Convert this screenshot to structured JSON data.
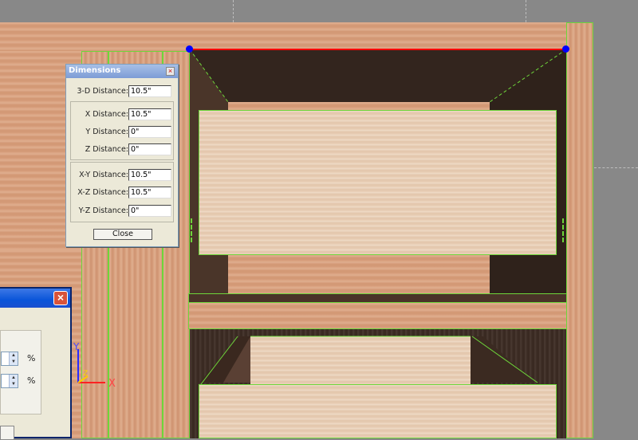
{
  "dimensions_dialog": {
    "title": "Dimensions",
    "close_glyph": "×",
    "rows": [
      {
        "label": "3-D Distance:",
        "value": "10.5\""
      },
      {
        "label": "X Distance:",
        "value": "10.5\""
      },
      {
        "label": "Y Distance:",
        "value": "0\""
      },
      {
        "label": "Z Distance:",
        "value": "0\""
      },
      {
        "label": "X-Y Distance:",
        "value": "10.5\""
      },
      {
        "label": "X-Z Distance:",
        "value": "10.5\""
      },
      {
        "label": "Y-Z Distance:",
        "value": "0\""
      }
    ],
    "close_button": "Close"
  },
  "side_dialog": {
    "close_glyph": "×",
    "percent_1": "%",
    "percent_2": "%"
  },
  "axes": {
    "y_label": "Y",
    "z_label": "Z",
    "x_label": "X"
  },
  "colors": {
    "selection_edge": "#ff0000",
    "selection_endpoint": "#0000ff",
    "edge_highlight": "#6ed63a"
  }
}
